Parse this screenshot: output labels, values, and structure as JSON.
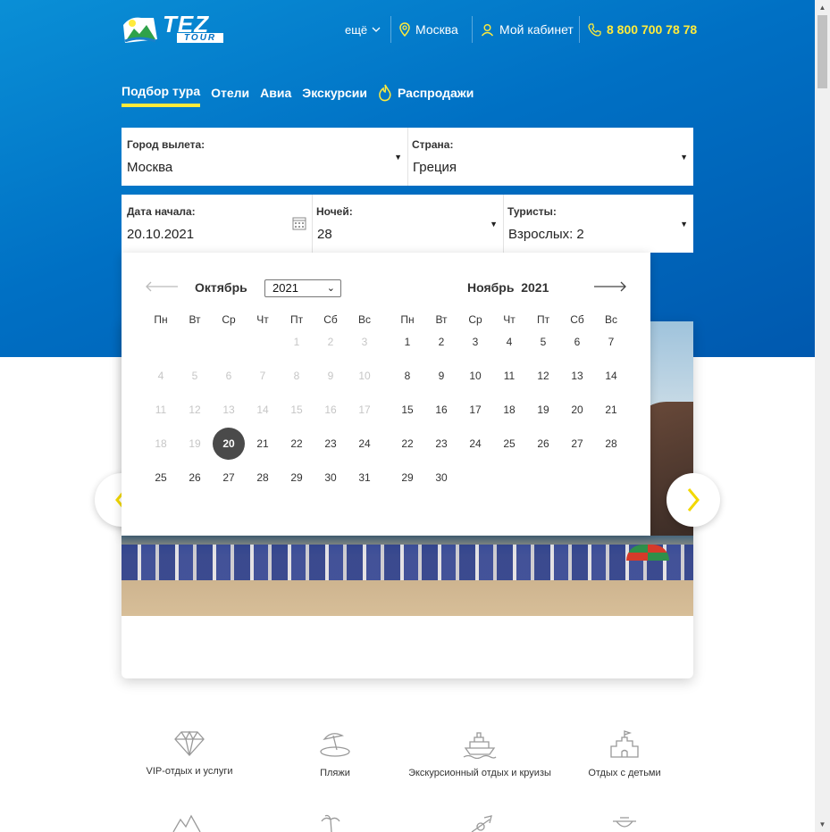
{
  "header": {
    "logo_text_1": "TEZ",
    "logo_text_2": "TOUR",
    "more_label": "ещё",
    "city": "Москва",
    "cabinet": "Мой кабинет",
    "phone": "8 800 700 78 78"
  },
  "tabs": [
    {
      "label": "Подбор тура",
      "active": true
    },
    {
      "label": "Отели"
    },
    {
      "label": "Авиа"
    },
    {
      "label": "Экскурсии"
    },
    {
      "label": "Распродажи",
      "icon": "flame-icon"
    }
  ],
  "search": {
    "departure_label": "Город вылета:",
    "departure_value": "Москва",
    "country_label": "Страна:",
    "country_value": "Греция",
    "date_label": "Дата начала:",
    "date_value": "20.10.2021",
    "nights_label": "Ночей:",
    "nights_value": "28",
    "tourists_label": "Туристы:",
    "tourists_value": "Взрослых: 2"
  },
  "calendar": {
    "left_month": "Октябрь",
    "left_year": "2021",
    "right_month": "Ноябрь",
    "right_year": "2021",
    "weekdays": [
      "Пн",
      "Вт",
      "Ср",
      "Чт",
      "Пт",
      "Сб",
      "Вс"
    ],
    "left_weeks": [
      [
        "",
        "",
        "",
        "",
        "1",
        "2",
        "3"
      ],
      [
        "4",
        "5",
        "6",
        "7",
        "8",
        "9",
        "10"
      ],
      [
        "11",
        "12",
        "13",
        "14",
        "15",
        "16",
        "17"
      ],
      [
        "18",
        "19",
        "20",
        "21",
        "22",
        "23",
        "24"
      ],
      [
        "25",
        "26",
        "27",
        "28",
        "29",
        "30",
        "31"
      ]
    ],
    "left_disabled_until": 19,
    "selected_day": "20",
    "right_weeks": [
      [
        "1",
        "2",
        "3",
        "4",
        "5",
        "6",
        "7"
      ],
      [
        "8",
        "9",
        "10",
        "11",
        "12",
        "13",
        "14"
      ],
      [
        "15",
        "16",
        "17",
        "18",
        "19",
        "20",
        "21"
      ],
      [
        "22",
        "23",
        "24",
        "25",
        "26",
        "27",
        "28"
      ],
      [
        "29",
        "30",
        "",
        "",
        "",
        "",
        ""
      ]
    ]
  },
  "categories": [
    {
      "label": "VIP-отдых и услуги",
      "icon": "diamond-icon"
    },
    {
      "label": "Пляжи",
      "icon": "beach-umbrella-icon"
    },
    {
      "label": "Экскурсионный отдых и круизы",
      "icon": "cruise-ship-icon"
    },
    {
      "label": "Отдых с детьми",
      "icon": "sandcastle-icon"
    }
  ],
  "colors": {
    "brand_blue": "#0070c4",
    "accent_yellow": "#ffeb3b",
    "selected_day": "#4a4a4a"
  }
}
